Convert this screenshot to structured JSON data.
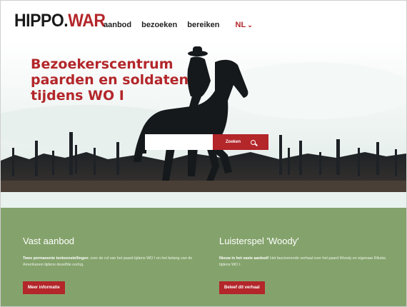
{
  "header": {
    "logo_part1": "HIPPO.",
    "logo_part2": "WAR",
    "nav": [
      "aanbod",
      "bezoeken",
      "bereiken"
    ],
    "language": "NL",
    "language_icon": "chevron-down-icon"
  },
  "hero": {
    "title_lines": [
      "Bezoekerscentrum",
      "paarden en soldaten",
      "tijdens WO I"
    ],
    "search": {
      "placeholder": "",
      "button_label": "Zoeken",
      "button_icon": "search-icon"
    }
  },
  "offers": [
    {
      "title": "Vast aanbod",
      "text_bold": "Twee permanente tentoonstellingen",
      "text": ": over de rol van het paard tijdens WO I en het belang van de Amerikanen tijdens dezelfde oorlog.",
      "button": "Meer informatie"
    },
    {
      "title": "Luisterspel 'Woody'",
      "text_bold": "Nieuw in het vaste aanbod!",
      "text": " Het fascinerende verhaal over het paard Woody en eigenaar Rikske, tijdens WO I.",
      "button": "Beleef dit verhaal"
    }
  ],
  "colors": {
    "brand_red": "#b3262a",
    "section_green": "#84a36c",
    "strip": "#eaf2f0"
  }
}
